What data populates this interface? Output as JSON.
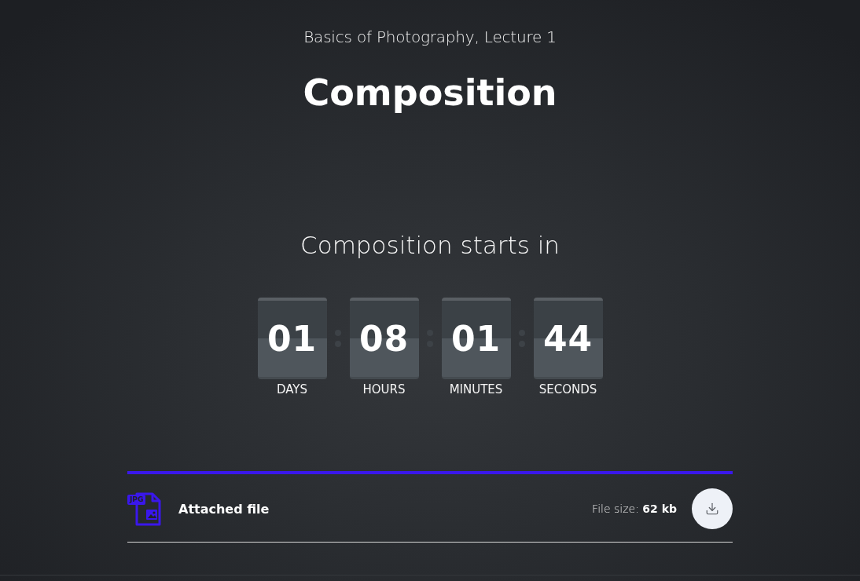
{
  "header": {
    "course": "Basics of Photography, Lecture 1",
    "title": "Composition"
  },
  "countdown": {
    "heading": "Composition starts in",
    "units": [
      {
        "value": "01",
        "label": "DAYS"
      },
      {
        "value": "08",
        "label": "HOURS"
      },
      {
        "value": "01",
        "label": "MINUTES"
      },
      {
        "value": "44",
        "label": "SECONDS"
      }
    ]
  },
  "attachment": {
    "file_type": "JPG",
    "name": "Attached file",
    "size": "File size: **62 kb**"
  }
}
